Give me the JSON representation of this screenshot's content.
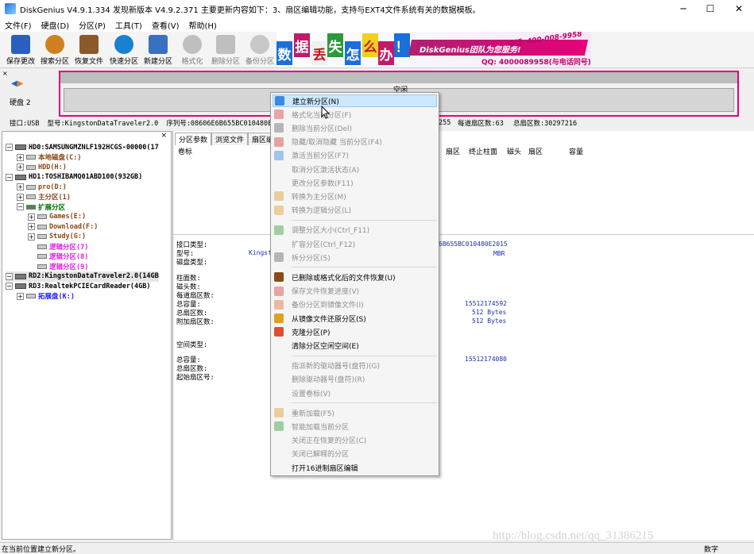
{
  "window": {
    "title": "DiskGenius V4.9.1.334    发现新版本 V4.9.2.371 主要更新内容如下：3、扇区编辑功能，支持与EXT4文件系统有关的数据模板。",
    "minimize": "─",
    "maximize": "☐",
    "close": "✕"
  },
  "menubar": [
    "文件(F)",
    "硬盘(D)",
    "分区(P)",
    "工具(T)",
    "查看(V)",
    "帮助(H)"
  ],
  "toolbar": {
    "buttons": [
      {
        "label": "保存更改",
        "icon": "save-icon",
        "disabled": false
      },
      {
        "label": "搜索分区",
        "icon": "search-partition-icon",
        "disabled": false
      },
      {
        "label": "恢复文件",
        "icon": "recover-file-icon",
        "disabled": false
      },
      {
        "label": "快速分区",
        "icon": "quick-partition-icon",
        "disabled": false
      },
      {
        "label": "新建分区",
        "icon": "new-partition-icon",
        "disabled": false
      },
      {
        "label": "格式化",
        "icon": "format-icon",
        "disabled": true
      },
      {
        "label": "删除分区",
        "icon": "delete-partition-icon",
        "disabled": true
      },
      {
        "label": "备份分区",
        "icon": "backup-partition-icon",
        "disabled": true
      }
    ]
  },
  "banner": {
    "chars": [
      "数",
      "据",
      "丢",
      "失",
      "怎",
      "么",
      "办",
      "！"
    ],
    "slogan": "DiskGenius团队为您服务!",
    "phone": "电话: 400-008-9958",
    "qq": "QQ: 4000089958(与电话同号)"
  },
  "disk_area": {
    "label": "硬盘 2",
    "free_label": "空闲"
  },
  "info_line": {
    "interface": "接口:USB",
    "model": "型号:KingstonDataTraveler2.0",
    "serial": "序列号:08606E6B655BC010480E201",
    "tail": "255",
    "sectors_per_track": "每道扇区数:63",
    "total_sectors": "总扇区数:30297216"
  },
  "tree": {
    "close": "×",
    "items": [
      {
        "text": "HD0:SAMSUNGMZNLF192HCGS-00000(17",
        "expander": "−",
        "type": "disk",
        "color": "#000000"
      },
      {
        "text": "本地磁盘(C:)",
        "expander": "+",
        "type": "part",
        "color": "#8b4513"
      },
      {
        "text": "HDD(H:)",
        "expander": "+",
        "type": "part",
        "color": "#8b4513"
      },
      {
        "text": "HD1:TOSHIBAMQ01ABD100(932GB)",
        "expander": "−",
        "type": "disk",
        "color": "#000000"
      },
      {
        "text": "pro(D:)",
        "expander": "+",
        "type": "part",
        "color": "#8b4513"
      },
      {
        "text": "主分区(1)",
        "expander": "+",
        "type": "part",
        "color": "#8b4513"
      },
      {
        "text": "扩展分区",
        "expander": "−",
        "type": "ext",
        "color": "#007000"
      },
      {
        "text": "Games(E:)",
        "expander": "+",
        "type": "part",
        "color": "#8b4513"
      },
      {
        "text": "Download(F:)",
        "expander": "+",
        "type": "part",
        "color": "#8b4513"
      },
      {
        "text": "Study(G:)",
        "expander": "+",
        "type": "part",
        "color": "#8b4513"
      },
      {
        "text": "逻辑分区(7)",
        "expander": "",
        "type": "part",
        "color": "#e21fe2"
      },
      {
        "text": "逻辑分区(8)",
        "expander": "",
        "type": "part",
        "color": "#e21fe2"
      },
      {
        "text": "逻辑分区(9)",
        "expander": "",
        "type": "part",
        "color": "#e21fe2"
      },
      {
        "text": "RD2:KingstonDataTraveler2.0(14GB",
        "expander": "−",
        "type": "disk",
        "color": "#000000"
      },
      {
        "text": "RD3:RealtekPCIECardReader(4GB)",
        "expander": "−",
        "type": "disk",
        "color": "#000000"
      },
      {
        "text": "拓展盘(K:)",
        "expander": "+",
        "type": "part",
        "color": "#1a1aff"
      }
    ]
  },
  "right_panel": {
    "tabs": [
      "分区参数",
      "浏览文件",
      "扇区编"
    ],
    "columns": {
      "vol": "卷标",
      "sector1": "扇区",
      "end_cyl": "终止柱面",
      "head": "磁头",
      "sector2": "扇区",
      "capacity": "容量"
    },
    "props": {
      "iface": "接口类型:",
      "model": "型号:",
      "model_val": "Kingst",
      "disk_type": "磁盘类型:",
      "serial_val": "6B655BC010480E2015",
      "mbr_val": "MBR",
      "cyl": "柱面数:",
      "heads": "磁头数:",
      "spt": "每道扇区数:",
      "cap": "总容量:",
      "total_sec": "总扇区数:",
      "extra_sec": "附加扇区数:",
      "cap_val": "15512174592",
      "bytes1": "512 Bytes",
      "bytes2": "512 Bytes",
      "space_type": "空间类型:",
      "tcap": "总容量:",
      "tsec": "总扇区数:",
      "start": "起始扇区号:",
      "tcap_val": "15512174080"
    }
  },
  "context_menu": {
    "items": [
      {
        "label": "建立新分区(N)",
        "disabled": false,
        "highlight": true,
        "icon": "new-partition-icon",
        "color": "#3a8be0"
      },
      {
        "label": "格式化当前分区(F)",
        "disabled": true,
        "highlight": false,
        "icon": "format-icon",
        "color": "#e04040"
      },
      {
        "label": "删除当前分区(Del)",
        "disabled": true,
        "highlight": false,
        "icon": "delete-icon",
        "color": "#6a6a6a"
      },
      {
        "label": "隐藏/取消隐藏 当前分区(F4)",
        "disabled": true,
        "highlight": false,
        "icon": "hide-icon",
        "color": "#d04040"
      },
      {
        "label": "激活当前分区(F7)",
        "disabled": true,
        "highlight": false,
        "icon": "activate-icon",
        "color": "#3a8be0"
      },
      {
        "label": "取消分区激活状态(A)",
        "disabled": true,
        "highlight": false,
        "icon": "",
        "color": ""
      },
      {
        "label": "更改分区参数(F11)",
        "disabled": true,
        "highlight": false,
        "icon": "",
        "color": ""
      },
      {
        "label": "转换为主分区(M)",
        "disabled": true,
        "highlight": false,
        "icon": "convert-primary-icon",
        "color": "#e0a030"
      },
      {
        "label": "转换为逻辑分区(L)",
        "disabled": true,
        "highlight": false,
        "icon": "convert-logical-icon",
        "color": "#e0a030"
      },
      {
        "sep": true
      },
      {
        "label": "调整分区大小(Ctrl_F11)",
        "disabled": true,
        "highlight": false,
        "icon": "resize-icon",
        "color": "#3aa040"
      },
      {
        "label": "扩容分区(Ctrl_F12)",
        "disabled": true,
        "highlight": false,
        "icon": "",
        "color": ""
      },
      {
        "label": "拆分分区(S)",
        "disabled": true,
        "highlight": false,
        "icon": "split-icon",
        "color": "#6a6a6a"
      },
      {
        "sep": true
      },
      {
        "label": "已删除或格式化后的文件恢复(U)",
        "disabled": false,
        "highlight": false,
        "icon": "recover-icon",
        "color": "#8b4a1a"
      },
      {
        "label": "保存文件恢复进度(V)",
        "disabled": true,
        "highlight": false,
        "icon": "save-progress-icon",
        "color": "#e04040"
      },
      {
        "label": "备份分区到镜像文件(I)",
        "disabled": true,
        "highlight": false,
        "icon": "backup-icon",
        "color": "#e07030"
      },
      {
        "label": "从镜像文件还原分区(S)",
        "disabled": false,
        "highlight": false,
        "icon": "restore-icon",
        "color": "#e0a020"
      },
      {
        "label": "克隆分区(P)",
        "disabled": false,
        "highlight": false,
        "icon": "clone-icon",
        "color": "#e05030"
      },
      {
        "label": "清除分区空闲空间(E)",
        "disabled": false,
        "highlight": false,
        "icon": "",
        "color": ""
      },
      {
        "sep": true
      },
      {
        "label": "指派新的驱动器号(盘符)(G)",
        "disabled": true,
        "highlight": false,
        "icon": "",
        "color": ""
      },
      {
        "label": "删除驱动器号(盘符)(R)",
        "disabled": true,
        "highlight": false,
        "icon": "",
        "color": ""
      },
      {
        "label": "设置卷标(V)",
        "disabled": true,
        "highlight": false,
        "icon": "",
        "color": ""
      },
      {
        "sep": true
      },
      {
        "label": "重新加载(F5)",
        "disabled": true,
        "highlight": false,
        "icon": "reload-icon",
        "color": "#e0a030"
      },
      {
        "label": "智能加载当前分区",
        "disabled": true,
        "highlight": false,
        "icon": "smart-load-icon",
        "color": "#3aa040"
      },
      {
        "label": "关闭正在恢复的分区(C)",
        "disabled": true,
        "highlight": false,
        "icon": "",
        "color": ""
      },
      {
        "label": "关闭已解释的分区",
        "disabled": true,
        "highlight": false,
        "icon": "",
        "color": ""
      },
      {
        "label": "打开16进制扇区编辑",
        "disabled": false,
        "highlight": false,
        "icon": "",
        "color": ""
      }
    ]
  },
  "statusbar": {
    "text": "在当前位置建立新分区。",
    "right": "数字"
  },
  "watermark": "http://blog.csdn.net/qq_31386215"
}
